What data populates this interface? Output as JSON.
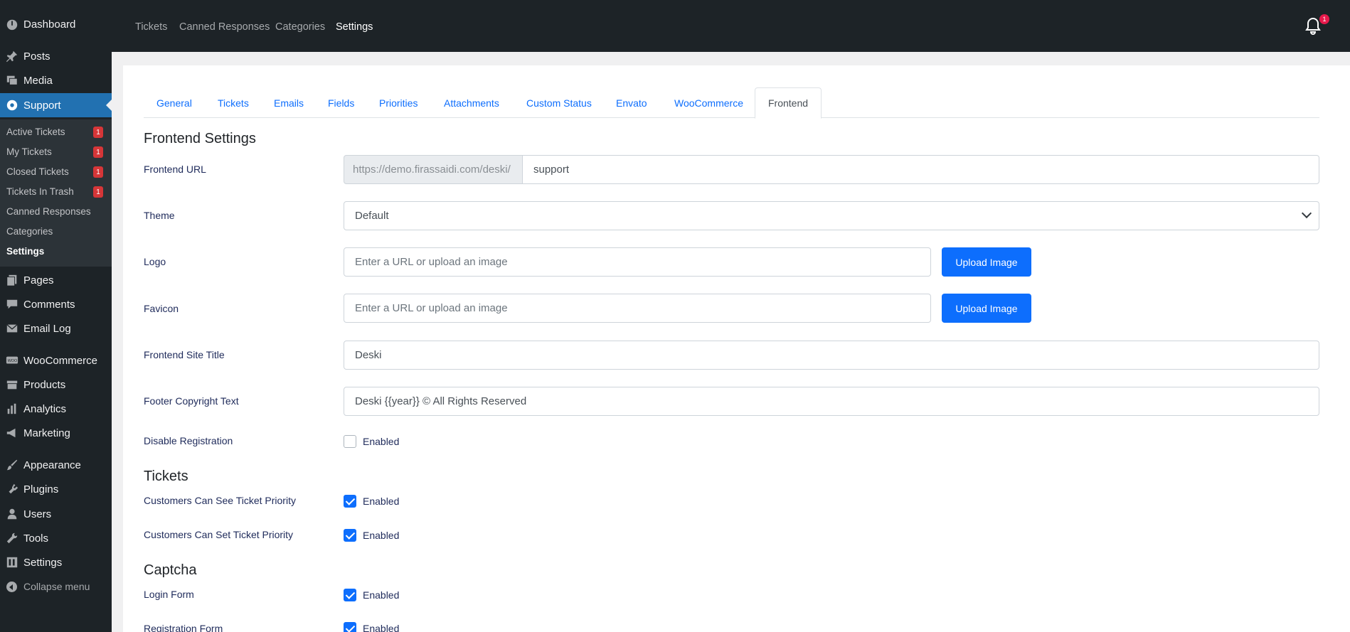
{
  "sidebar": {
    "items": [
      {
        "label": "Dashboard",
        "icon": "dashboard-icon"
      },
      {
        "label": "Posts",
        "icon": "pin-icon"
      },
      {
        "label": "Media",
        "icon": "media-icon"
      },
      {
        "label": "Support",
        "icon": "support-icon"
      },
      {
        "label": "Pages",
        "icon": "pages-icon"
      },
      {
        "label": "Comments",
        "icon": "comments-icon"
      },
      {
        "label": "Email Log",
        "icon": "email-icon"
      },
      {
        "label": "WooCommerce",
        "icon": "woo-icon"
      },
      {
        "label": "Products",
        "icon": "products-icon"
      },
      {
        "label": "Analytics",
        "icon": "analytics-icon"
      },
      {
        "label": "Marketing",
        "icon": "megaphone-icon"
      },
      {
        "label": "Appearance",
        "icon": "brush-icon"
      },
      {
        "label": "Plugins",
        "icon": "plugin-icon"
      },
      {
        "label": "Users",
        "icon": "user-icon"
      },
      {
        "label": "Tools",
        "icon": "wrench-icon"
      },
      {
        "label": "Settings",
        "icon": "settings-icon"
      }
    ],
    "submenu": [
      {
        "label": "Active Tickets",
        "badge": "1"
      },
      {
        "label": "My Tickets",
        "badge": "1"
      },
      {
        "label": "Closed Tickets",
        "badge": "1"
      },
      {
        "label": "Tickets In Trash",
        "badge": "1"
      },
      {
        "label": "Canned Responses",
        "badge": ""
      },
      {
        "label": "Categories",
        "badge": ""
      },
      {
        "label": "Settings",
        "badge": ""
      }
    ],
    "collapse_label": "Collapse menu"
  },
  "topbar": {
    "links": [
      "Tickets",
      "Canned Responses",
      "Categories",
      "Settings"
    ],
    "notification_count": "1"
  },
  "tabs": [
    "General",
    "Tickets",
    "Emails",
    "Fields",
    "Priorities",
    "Attachments",
    "Custom Status",
    "Envato",
    "WooCommerce",
    "Frontend"
  ],
  "form": {
    "section_frontend": "Frontend Settings",
    "frontend_url_label": "Frontend URL",
    "frontend_url_prefix": "https://demo.firassaidi.com/deski/",
    "frontend_url_value": "support",
    "theme_label": "Theme",
    "theme_value": "Default",
    "logo_label": "Logo",
    "logo_placeholder": "Enter a URL or upload an image",
    "favicon_label": "Favicon",
    "favicon_placeholder": "Enter a URL or upload an image",
    "upload_label": "Upload Image",
    "site_title_label": "Frontend Site Title",
    "site_title_value": "Deski",
    "footer_label": "Footer Copyright Text",
    "footer_value": "Deski {{year}} © All Rights Reserved",
    "disable_reg_label": "Disable Registration",
    "enabled_text": "Enabled",
    "section_tickets": "Tickets",
    "see_priority_label": "Customers Can See Ticket Priority",
    "set_priority_label": "Customers Can Set Ticket Priority",
    "section_captcha": "Captcha",
    "login_form_label": "Login Form",
    "registration_form_label": "Registration Form"
  },
  "checkboxes": {
    "disable_registration": false,
    "see_priority": true,
    "set_priority": true,
    "login_form": true,
    "registration_form": true
  }
}
